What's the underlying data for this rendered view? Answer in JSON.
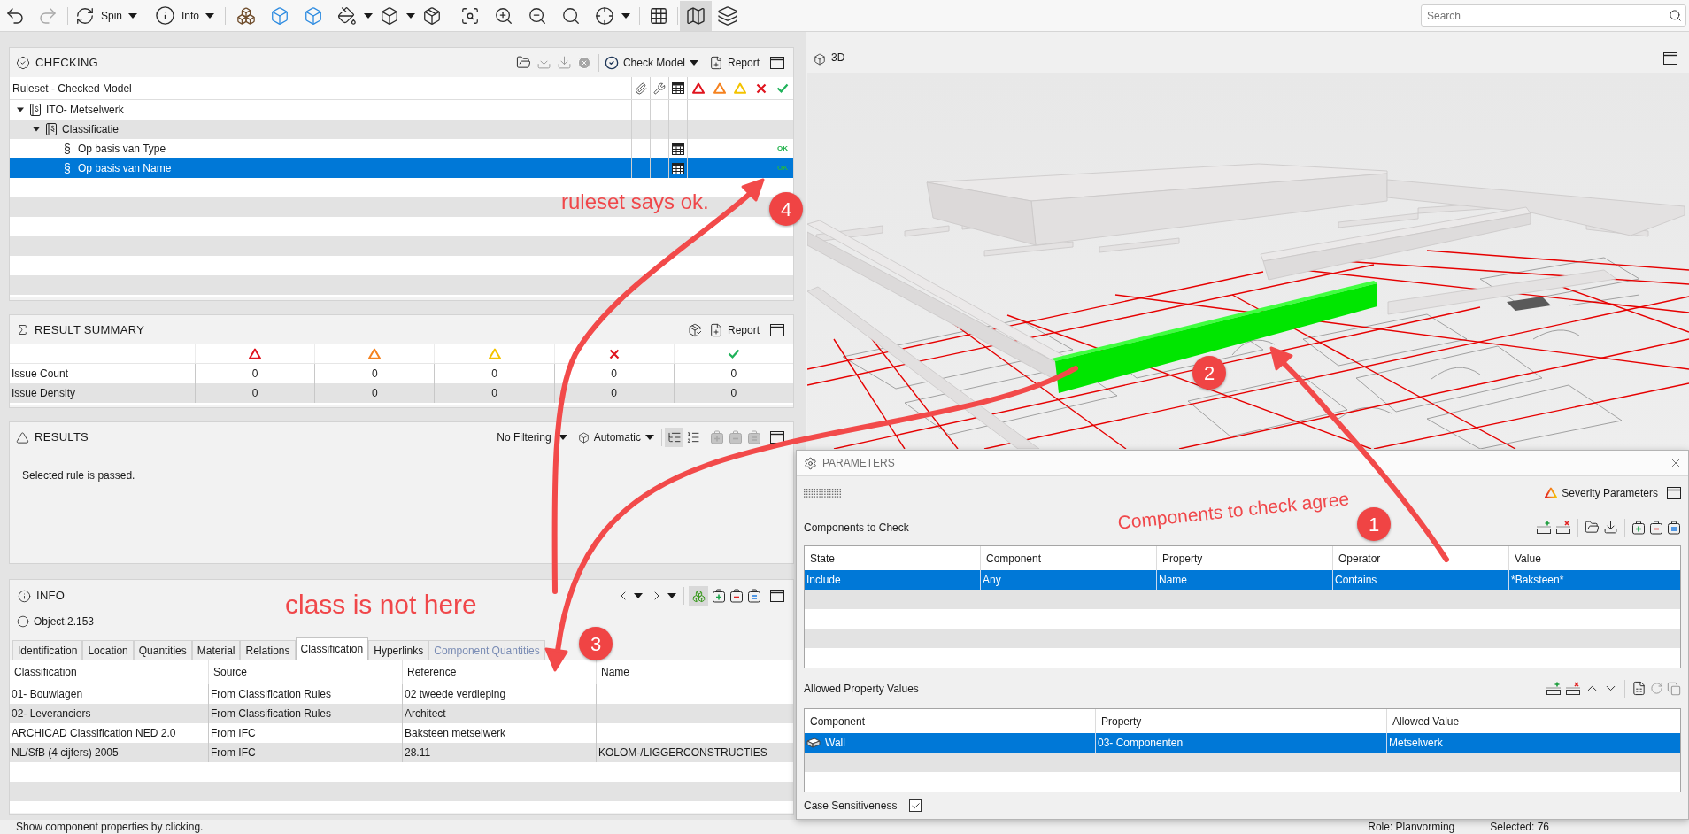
{
  "toolbar": {
    "spin": "Spin",
    "info": "Info",
    "map_view": {
      "on": true
    },
    "search": {
      "placeholder": "Search"
    }
  },
  "checking": {
    "title": "CHECKING",
    "check_model": "Check Model",
    "report": "Report",
    "column": "Ruleset - Checked Model",
    "tree": [
      {
        "label": "ITO- Metselwerk",
        "kind": "ruleset",
        "expanded": true,
        "selected": false,
        "children": [
          {
            "label": "Classificatie",
            "kind": "folder",
            "expanded": true,
            "selected": false,
            "children": [
              {
                "label": "Op basis van Type",
                "kind": "rule",
                "marker": "§",
                "status": "OK",
                "selected": false
              },
              {
                "label": "Op basis van Name",
                "kind": "rule",
                "marker": "§",
                "status": "OK",
                "selected": true
              }
            ]
          }
        ]
      }
    ]
  },
  "result_summary": {
    "title": "RESULT SUMMARY",
    "report": "Report",
    "rows": [
      {
        "label": "Issue Count",
        "values": [
          "0",
          "0",
          "0",
          "0",
          "0"
        ]
      },
      {
        "label": "Issue Density",
        "values": [
          "0",
          "0",
          "0",
          "0",
          "0"
        ]
      }
    ]
  },
  "results": {
    "title": "RESULTS",
    "filter": "No Filtering",
    "mode": "Automatic",
    "view_modes": [
      {
        "kind": "tree",
        "selected": true
      },
      {
        "kind": "list",
        "selected": false
      }
    ],
    "message": "Selected rule is passed."
  },
  "info": {
    "title": "INFO",
    "highlight": {
      "on": true
    },
    "object": "Object.2.153",
    "tabs": [
      {
        "label": "Identification",
        "selected": false,
        "disabled": false
      },
      {
        "label": "Location",
        "selected": false,
        "disabled": false
      },
      {
        "label": "Quantities",
        "selected": false,
        "disabled": false
      },
      {
        "label": "Material",
        "selected": false,
        "disabled": false
      },
      {
        "label": "Relations",
        "selected": false,
        "disabled": false
      },
      {
        "label": "Classification",
        "selected": true,
        "disabled": false
      },
      {
        "label": "Hyperlinks",
        "selected": false,
        "disabled": false
      },
      {
        "label": "Component Quantities",
        "selected": false,
        "disabled": true
      }
    ],
    "table": {
      "columns": [
        "Classification",
        "Source",
        "Reference",
        "Name"
      ],
      "rows": [
        {
          "classification": "01- Bouwlagen",
          "source": "From Classification Rules",
          "reference": "02 tweede verdieping"
        },
        {
          "classification": "02- Leveranciers",
          "source": "From Classification Rules",
          "reference": "Architect"
        },
        {
          "classification": "ARCHICAD Classification NED 2.0",
          "source": "From IFC",
          "reference": "Baksteen metselwerk"
        },
        {
          "classification": "NL/SfB (4 cijfers) 2005",
          "source": "From IFC",
          "reference": "28.11",
          "name": "KOLOM-/LIGGERCONSTRUCTIES"
        }
      ]
    }
  },
  "view_3d": {
    "title": "3D"
  },
  "parameters": {
    "title": "PARAMETERS",
    "severity_button": "Severity Parameters",
    "components_to_check": {
      "label": "Components to Check",
      "columns": [
        "State",
        "Component",
        "Property",
        "Operator",
        "Value"
      ],
      "rows": [
        {
          "cells": [
            "Include",
            "Any",
            "Name",
            "Contains",
            "*Baksteen*"
          ],
          "selected": true
        }
      ]
    },
    "allowed_values": {
      "label": "Allowed Property Values",
      "columns": [
        "Component",
        "Property",
        "Allowed Value"
      ],
      "rows": [
        {
          "cells": [
            "Wall",
            "03- Componenten",
            "Metselwerk"
          ],
          "selected": true
        }
      ]
    },
    "case_sensitiveness": {
      "label": "Case Sensitiveness",
      "checked": true
    }
  },
  "status_bar": {
    "hint": "Show component properties by clicking.",
    "role": "Role: Planvorming",
    "selection": "Selected: 76"
  },
  "annotations": [
    {
      "text": "ruleset says ok.",
      "number": "4"
    },
    {
      "number": "2"
    },
    {
      "text": "Components to check agree",
      "number": "1"
    },
    {
      "text": "class is not here",
      "number": "3"
    }
  ]
}
